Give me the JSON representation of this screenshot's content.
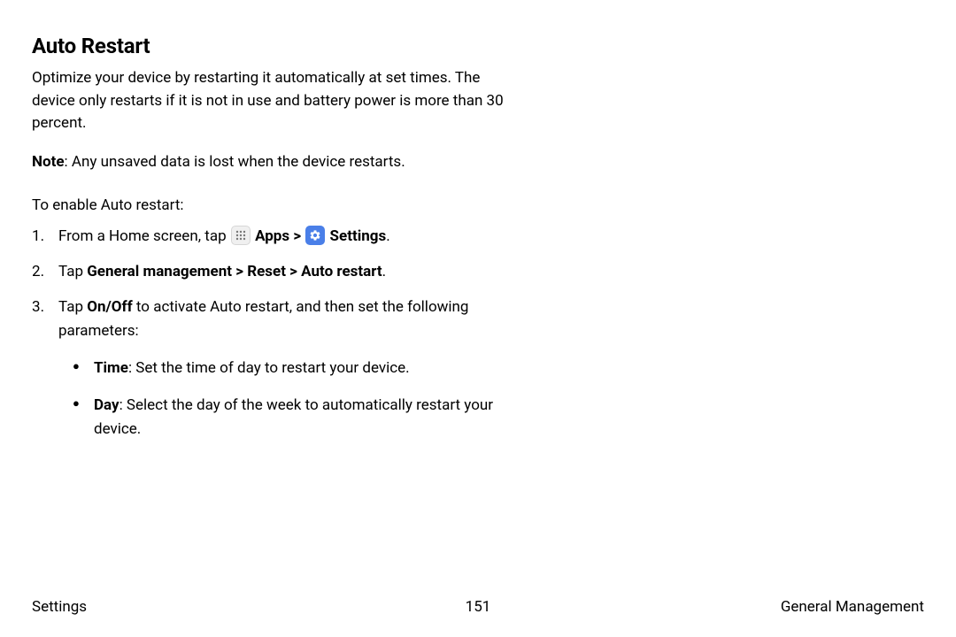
{
  "title": "Auto Restart",
  "intro": "Optimize your device by restarting it automatically at set times. The device only restarts if it is not in use and battery power is more than 30 percent.",
  "note_label": "Note",
  "note_text": ": Any unsaved data is lost when the device restarts.",
  "enable_label": "To enable Auto restart:",
  "step1": {
    "pre": "From a Home screen, tap ",
    "apps": "Apps",
    "sep": " > ",
    "settings": "Settings",
    "end": "."
  },
  "step2": {
    "pre": "Tap ",
    "path": "General management > Reset > Auto restart",
    "end": "."
  },
  "step3": {
    "pre": "Tap ",
    "onoff": "On/Off",
    "post": " to activate Auto restart, and then set the following parameters:"
  },
  "bullets": {
    "time_label": "Time",
    "time_text": ": Set the time of day to restart your device.",
    "day_label": "Day",
    "day_text": ": Select the day of the week to automatically restart your device."
  },
  "footer": {
    "left": "Settings",
    "page": "151",
    "right": "General Management"
  }
}
